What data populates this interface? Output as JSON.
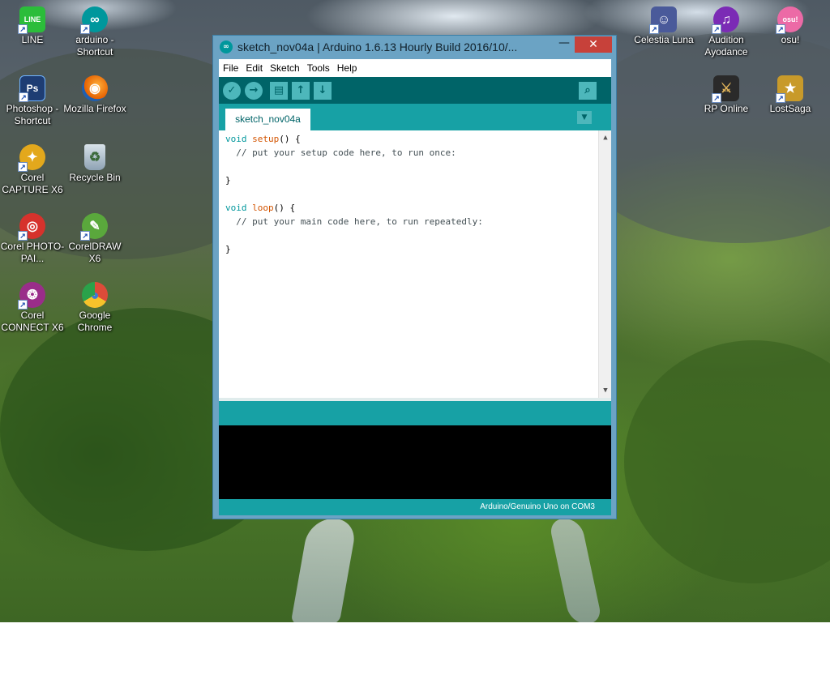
{
  "desktop_icons": [
    {
      "label": "LINE",
      "glyph": "LINE",
      "color": "#2bbd3a"
    },
    {
      "label": "arduino - Shortcut",
      "glyph": "∞",
      "color": "#00979c"
    },
    {
      "label": "Photoshop - Shortcut",
      "glyph": "Ps",
      "color": "#1e3d73"
    },
    {
      "label": "Mozilla Firefox",
      "glyph": "◉",
      "color": "#e66000"
    },
    {
      "label": "Corel CAPTURE X6",
      "glyph": "✦",
      "color": "#e3a81c"
    },
    {
      "label": "Recycle Bin",
      "glyph": "♻",
      "color": "#8ea2b4"
    },
    {
      "label": "Corel PHOTO-PAI...",
      "glyph": "◎",
      "color": "#d6322c"
    },
    {
      "label": "CorelDRAW X6",
      "glyph": "✎",
      "color": "#5aa83c"
    },
    {
      "label": "Corel CONNECT X6",
      "glyph": "❂",
      "color": "#9a2d8a"
    },
    {
      "label": "Google Chrome",
      "glyph": "◕",
      "color": "#dd4b39"
    },
    {
      "label": "Celestia Luna",
      "glyph": "☺",
      "color": "#4a5a9a"
    },
    {
      "label": "Audition Ayodance",
      "glyph": "♫",
      "color": "#7b2bb5"
    },
    {
      "label": "osu!",
      "glyph": "osu!",
      "color": "#ec6aa6"
    },
    {
      "label": "RP Online",
      "glyph": "⚔",
      "color": "#2a2a2a"
    },
    {
      "label": "LostSaga",
      "glyph": "★",
      "color": "#c89a2a"
    }
  ],
  "window": {
    "title": "sketch_nov04a | Arduino 1.6.13 Hourly Build 2016/10/...",
    "minimize": "—",
    "close": "✕"
  },
  "menu": [
    "File",
    "Edit",
    "Sketch",
    "Tools",
    "Help"
  ],
  "toolbar": {
    "verify": "✓",
    "upload": "→",
    "new": "▤",
    "open": "↑",
    "save": "↓",
    "serial_monitor": "⌕"
  },
  "tab": {
    "label": "sketch_nov04a",
    "menu": "▼"
  },
  "code": {
    "l1_kw": "void",
    "l1_fn": "setup",
    "l1_rest": "() {",
    "l2": "  // put your setup code here, to run once:",
    "l4": "}",
    "l6_kw": "void",
    "l6_fn": "loop",
    "l6_rest": "() {",
    "l7": "  // put your main code here, to run repeatedly:",
    "l9": "}"
  },
  "scroll": {
    "up": "▲",
    "down": "▼"
  },
  "footer": {
    "board_status": "Arduino/Genuino Uno on COM3"
  }
}
